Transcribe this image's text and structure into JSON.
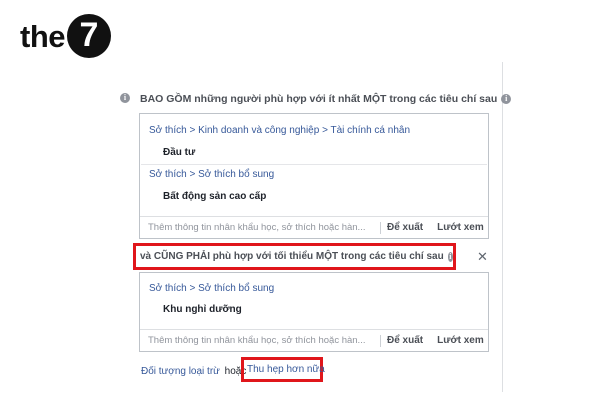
{
  "logo": {
    "text": "the",
    "numeral": "7"
  },
  "include": {
    "header": "BAO GỒM những người phù hợp với ít nhất MỘT trong các tiêu chí sau",
    "groups": [
      {
        "path": "Sở thích > Kinh doanh và công nghiệp > Tài chính cá nhân",
        "item": "Đầu tư"
      },
      {
        "path": "Sở thích > Sở thích bổ sung",
        "item": "Bất động sản cao cấp"
      }
    ],
    "input_placeholder": "Thêm thông tin nhân khẩu học, sở thích hoặc hàn...",
    "suggest_label": "Để xuất",
    "browse_label": "Lướt xem"
  },
  "narrow": {
    "header": "và CŨNG PHẢI phù hợp với tối thiểu MỘT trong các tiêu chí sau",
    "close_label": "✕",
    "groups": [
      {
        "path": "Sở thích > Sở thích bổ sung",
        "item": "Khu nghỉ dưỡng"
      }
    ],
    "input_placeholder": "Thêm thông tin nhân khẩu học, sở thích hoặc hàn...",
    "suggest_label": "Để xuất",
    "browse_label": "Lướt xem"
  },
  "bottom": {
    "exclude_label": "Đối tượng loại trừ",
    "or_label": "hoặc",
    "narrow_further_label": "Thu hẹp hơn nữa"
  },
  "colors": {
    "highlight": "#e0161b",
    "link": "#365899"
  },
  "icons": {
    "info": "info-icon",
    "close": "close-icon"
  }
}
